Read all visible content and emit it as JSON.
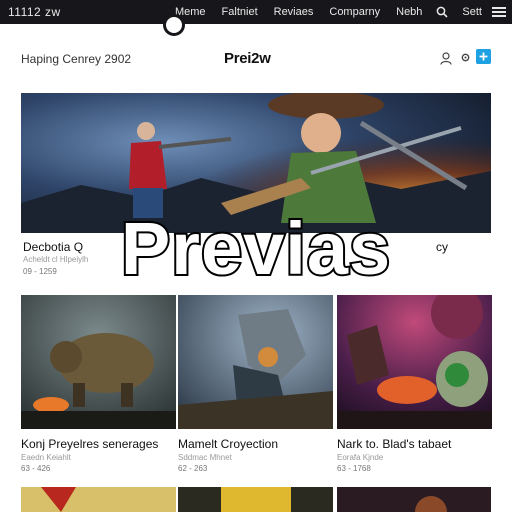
{
  "status": {
    "time": "11112 zw"
  },
  "topnav": {
    "items": [
      "Meme",
      "Faltniet",
      "Reviaes",
      "Comparny",
      "Nebh"
    ],
    "more_label": "Sett"
  },
  "header": {
    "tagline": "Haping Cenrey 2902",
    "logo": "Prei2w",
    "accent_color": "#1da1e2"
  },
  "hero": {
    "title": "Decbotia Q",
    "title_right": "cy",
    "meta": "Acheldt cl Hlpeiylh",
    "date": "09 -  1259"
  },
  "overlay": {
    "text": "Previas"
  },
  "cards": [
    {
      "title": "Konj Preyelres senerages",
      "sub": "Eaedn Keiahlt",
      "date": "63 - 426"
    },
    {
      "title": "Mamelt Croyection",
      "sub": "Sddmac Mhnet",
      "date": "62 -  263"
    },
    {
      "title": "Nark to. Blad's tabaet",
      "sub": "Eorafa Kjnde",
      "date": "63 -  1768"
    }
  ],
  "icons": {
    "search": "search-icon",
    "menu": "menu-icon",
    "user": "user-icon",
    "settings": "gear-icon",
    "add": "plus-icon"
  }
}
